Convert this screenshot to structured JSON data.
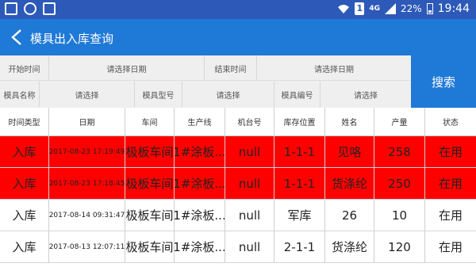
{
  "status_bar": {
    "network": "4G",
    "battery": "22%",
    "time": "19:44",
    "sim_label": "1"
  },
  "header": {
    "title": "模具出入库查询"
  },
  "filters": {
    "start_time_label": "开始时间",
    "start_time_placeholder": "请选择日期",
    "end_time_label": "结束时间",
    "end_time_placeholder": "请选择日期",
    "mold_name_label": "模具名称",
    "mold_name_placeholder": "请选择",
    "mold_model_label": "模具型号",
    "mold_model_placeholder": "请选择",
    "mold_code_label": "模具编号",
    "mold_code_placeholder": "请选择",
    "search_label": "搜索"
  },
  "table": {
    "columns": [
      "时间类型",
      "日期",
      "车间",
      "生产线",
      "机台号",
      "库存位置",
      "姓名",
      "产量",
      "状态"
    ],
    "rows": [
      {
        "type": "入库",
        "date": "2017-08-23 17:19:49",
        "workshop": "极板车间",
        "line": "1#涂板...",
        "machine": "null",
        "location": "1-1-1",
        "name": "见咯",
        "output": "258",
        "status": "在用",
        "highlight": true
      },
      {
        "type": "入库",
        "date": "2017-08-23 17:18:45",
        "workshop": "极板车间",
        "line": "1#涂板...",
        "machine": "null",
        "location": "1-1-1",
        "name": "货涤纶",
        "output": "250",
        "status": "在用",
        "highlight": true
      },
      {
        "type": "入库",
        "date": "2017-08-14 09:31:47",
        "workshop": "极板车间",
        "line": "1#涂板...",
        "machine": "null",
        "location": "军库",
        "name": "26",
        "output": "10",
        "status": "在用",
        "highlight": false
      },
      {
        "type": "入库",
        "date": "2017-08-13 12:07:11",
        "workshop": "极板车间",
        "line": "1#涂板...",
        "machine": "null",
        "location": "2-1-1",
        "name": "货涤纶",
        "output": "120",
        "status": "在用",
        "highlight": false
      }
    ]
  },
  "colors": {
    "status_bar": "#2d59b8",
    "header": "#1f79d6",
    "highlight_row": "#ff0000"
  }
}
